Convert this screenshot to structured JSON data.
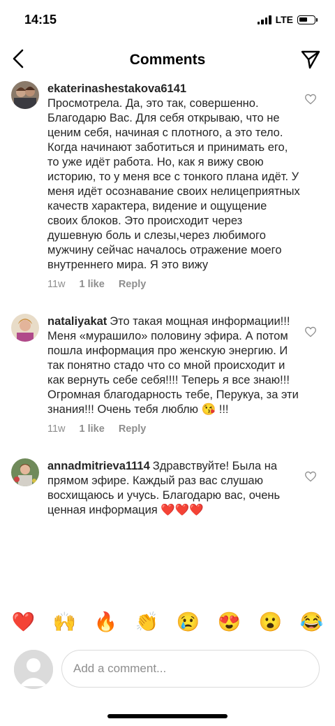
{
  "status_bar": {
    "time": "14:15",
    "network": "LTE",
    "battery_level": 0.6
  },
  "header": {
    "title": "Comments",
    "back_icon": "chevron-left-icon",
    "send_icon": "paper-plane-icon"
  },
  "comments": [
    {
      "username": "ekaterinashestakova6141",
      "text": "Просмотрела. Да, это так, совершенно. Благодарю Вас. Для себя открываю, что не ценим себя, начиная с плотного, а это тело. Когда начинают заботиться и принимать его, то уже идёт работа. Но, как я вижу свою историю, то у меня все с тонкого плана идёт. У меня идёт осознавание своих нелицеприятных качеств характера, видение и ощущение своих блоков. Это происходит через душевную боль и слезы,через любимого мужчину сейчас началось отражение моего внутреннего мира. Я это вижу",
      "time": "11w",
      "likes": "1 like",
      "reply": "Reply"
    },
    {
      "username": "nataliyakat",
      "text": "Это такая мощная информации!!! Меня «мурашило» половину эфира. А потом пошла информация про женскую энергию.  И так понятно стадо что со мной происходит и как вернуть себе себя!!!! Теперь я все знаю!!! Огромная благодарность тебе, Перукуа, за эти знания!!! Очень тебя люблю 😘 !!!",
      "time": "11w",
      "likes": "1 like",
      "reply": "Reply"
    },
    {
      "username": "annadmitrieva1114",
      "text": "Здравствуйте! Была на прямом эфире. Каждый раз вас слушаю восхищаюсь и учусь. Благодарю вас,  очень ценная информация ❤️❤️❤️",
      "time": "",
      "likes": "",
      "reply": ""
    }
  ],
  "emoji_bar": [
    "❤️",
    "🙌",
    "🔥",
    "👏",
    "😢",
    "😍",
    "😮",
    "😂"
  ],
  "composer": {
    "placeholder": "Add a comment..."
  },
  "colors": {
    "text": "#262626",
    "muted": "#8e8e8e",
    "border": "#dbdbdb"
  }
}
